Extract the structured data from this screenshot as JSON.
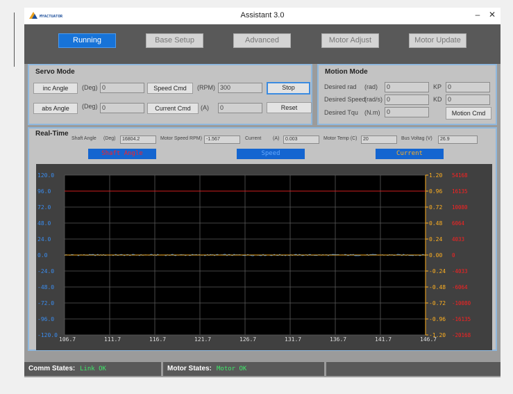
{
  "window": {
    "title": "Assistant 3.0",
    "logo_text": "MYACTUATOR",
    "minimize_glyph": "–",
    "close_glyph": "✕"
  },
  "tabs": [
    {
      "label": "Running",
      "active": true
    },
    {
      "label": "Base Setup",
      "active": false
    },
    {
      "label": "Advanced",
      "active": false
    },
    {
      "label": "Motor Adjust",
      "active": false
    },
    {
      "label": "Motor Update",
      "active": false
    }
  ],
  "servo_mode": {
    "title": "Servo Mode",
    "inc_angle_button": "inc Angle",
    "inc_angle_unit": "(Deg)",
    "inc_angle_value": "0",
    "speed_cmd_button": "Speed Cmd",
    "speed_cmd_unit": "(RPM)",
    "speed_cmd_value": "300",
    "stop_button": "Stop",
    "abs_angle_button": "abs Angle",
    "abs_angle_unit": "(Deg)",
    "abs_angle_value": "0",
    "current_cmd_button": "Current Cmd",
    "current_cmd_unit": "(A)",
    "current_cmd_value": "0",
    "reset_button": "Reset"
  },
  "motion_mode": {
    "title": "Motion Mode",
    "desired_rad_label": "Desired rad",
    "desired_rad_unit": "(rad)",
    "desired_rad_value": "0",
    "desired_speed_label": "Desired Speed",
    "desired_speed_unit": "(rad/s)",
    "desired_speed_value": "0",
    "desired_tqu_label": "Desired Tqu",
    "desired_tqu_unit": "(N.m)",
    "desired_tqu_value": "0",
    "kp_label": "KP",
    "kp_value": "0",
    "kd_label": "KD",
    "kd_value": "0",
    "motion_cmd_button": "Motion Cmd"
  },
  "realtime": {
    "title": "Real-Time",
    "shaft_angle_label": "Shaft Angle",
    "shaft_angle_unit": "(Deg)",
    "shaft_angle_value": "16804.2",
    "motor_speed_label": "Motor Speed RPM)",
    "motor_speed_value": "-1.567",
    "current_label": "Current",
    "current_unit": "(A)",
    "current_value": "0.003",
    "motor_temp_label": "Motor Temp (C)",
    "motor_temp_value": "20",
    "bus_voltage_label": "Bus Voltag (V)",
    "bus_voltage_value": "26.9",
    "legend": [
      {
        "label": "Shaft Angle",
        "color": "#ff2020"
      },
      {
        "label": "Speed",
        "color": "#66aaff"
      },
      {
        "label": "Current",
        "color": "#ffb020"
      }
    ]
  },
  "chart_data": {
    "type": "line",
    "title": "",
    "xlabel": "",
    "ylabel": "",
    "xlim": [
      106.7,
      146.7
    ],
    "x_ticks": [
      "106.7",
      "111.7",
      "116.7",
      "121.7",
      "126.7",
      "131.7",
      "136.7",
      "141.7",
      "146.7"
    ],
    "y_left_ticks": [
      "120.0",
      "96.0",
      "72.0",
      "48.0",
      "24.0",
      "0.0",
      "-24.0",
      "-48.0",
      "-72.0",
      "-96.0",
      "-120.0"
    ],
    "y_right1_ticks": [
      "1.20",
      "0.96",
      "0.72",
      "0.48",
      "0.24",
      "0.00",
      "-0.24",
      "-0.48",
      "-0.72",
      "-0.96",
      "-1.20"
    ],
    "y_right2_ticks": [
      "54168",
      "16135",
      "10080",
      "6064",
      "4033",
      "0",
      "-4033",
      "-6064",
      "-10080",
      "-16135",
      "-20168"
    ],
    "ylim": [
      -120,
      120
    ],
    "grid": true,
    "series": [
      {
        "name": "Shaft Angle",
        "color": "#d02020",
        "x": [
          106.7,
          146.7
        ],
        "y": [
          96.0,
          96.0
        ]
      },
      {
        "name": "Speed",
        "color": "#2a8cff",
        "x": [
          106.7,
          146.7
        ],
        "y": [
          0.0,
          0.0
        ],
        "noise": 1.2
      },
      {
        "name": "Current",
        "color": "#ffb020",
        "x": [
          106.7,
          146.7
        ],
        "y": [
          0.0,
          0.0
        ]
      }
    ]
  },
  "status": {
    "comm_label": "Comm States:",
    "comm_value": "Link OK",
    "motor_label": "Motor States:",
    "motor_value": "Motor OK"
  }
}
